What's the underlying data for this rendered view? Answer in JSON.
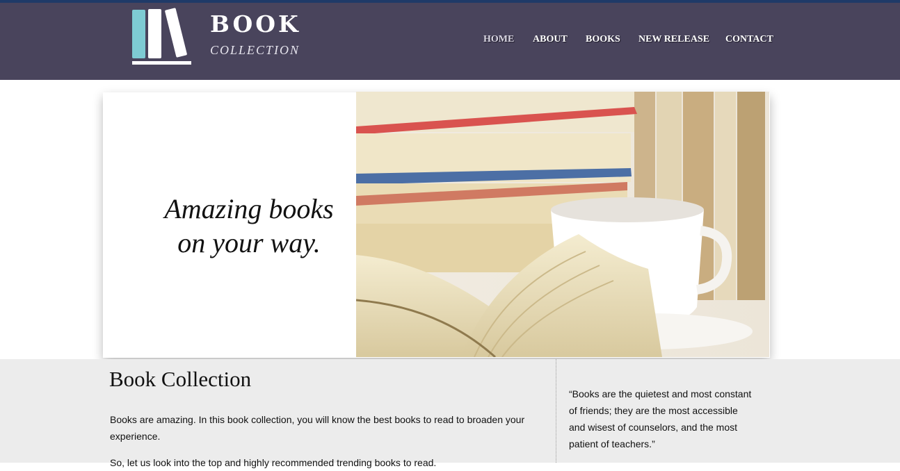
{
  "brand": {
    "title": "BOOK",
    "subtitle": "COLLECTION"
  },
  "nav": {
    "items": [
      {
        "label": "HOME",
        "active": true
      },
      {
        "label": "ABOUT"
      },
      {
        "label": "BOOKS"
      },
      {
        "label": "NEW RELEASE"
      },
      {
        "label": "CONTACT"
      }
    ]
  },
  "hero": {
    "line1": "Amazing books",
    "line2": "on your way."
  },
  "main": {
    "title": "Book Collection",
    "paragraph1": "Books are amazing. In this book collection, you will know the best books to read to broaden your experience.",
    "paragraph2": "So, let us look into the top and highly recommended trending books to read."
  },
  "sidebar": {
    "quote": "“Books are the quietest and most constant of friends; they are the most accessible and wisest of counselors, and the most patient of teachers.”"
  },
  "colors": {
    "header_bg": "#49445c",
    "top_line": "#1f3a68",
    "logo_accent": "#7ecbd3",
    "content_bg": "#ececec"
  }
}
